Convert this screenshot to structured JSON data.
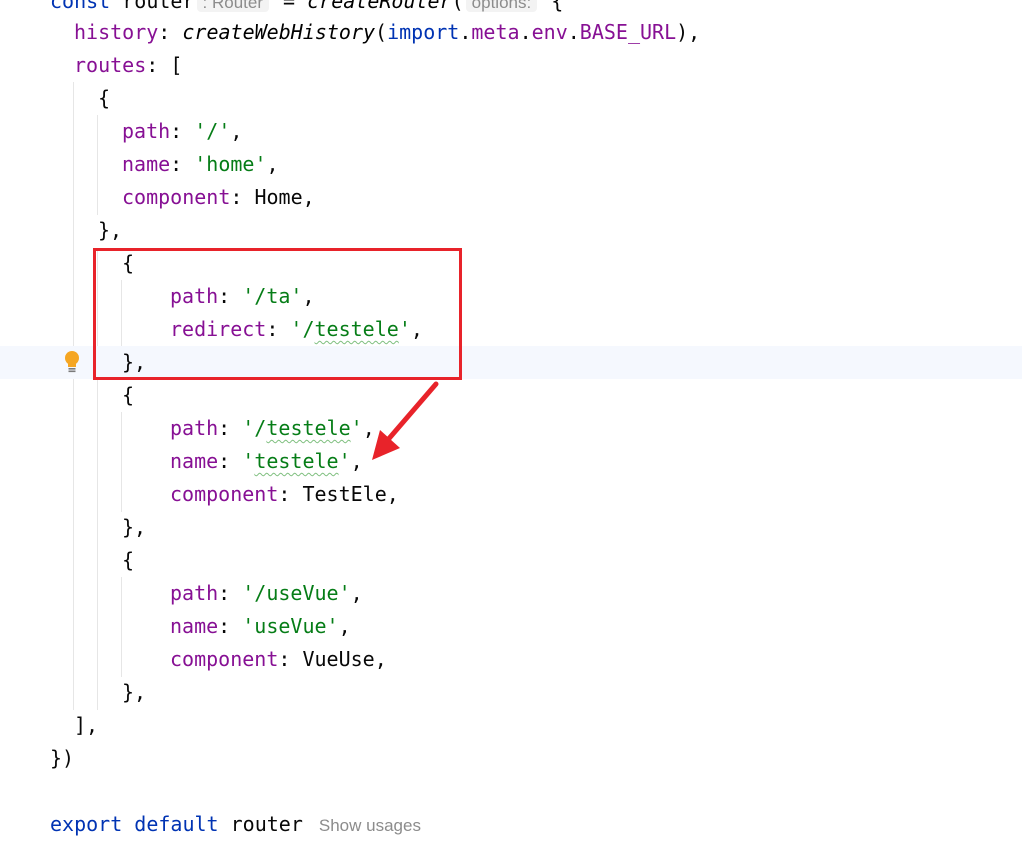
{
  "editor": {
    "l0": {
      "kw": "const",
      "id": "router",
      "hint": ": Router",
      "eq": " = ",
      "fn": "createRouter",
      "open": "(",
      "hint2": "options:",
      "brace": " {"
    },
    "l1": {
      "prop": "history",
      "colon": ": ",
      "fn": "createWebHistory",
      "p1": "(",
      "kw": "import",
      "d1": ".",
      "c1": "meta",
      "d2": ".",
      "c2": "env",
      "d3": ".",
      "c3": "BASE_URL",
      "end": "),"
    },
    "l2": {
      "prop": "routes",
      "rest": ": ["
    },
    "l3": {
      "text": "{"
    },
    "l4": {
      "prop": "path",
      "colon": ": ",
      "str": "'/'",
      "end": ","
    },
    "l5": {
      "prop": "name",
      "colon": ": ",
      "str": "'home'",
      "end": ","
    },
    "l6": {
      "prop": "component",
      "colon": ": ",
      "val": "Home,"
    },
    "l7": {
      "text": "},"
    },
    "l8": {
      "text": "{"
    },
    "l9": {
      "prop": "path",
      "colon": ": ",
      "str": "'/ta'",
      "end": ","
    },
    "l10": {
      "prop": "redirect",
      "colon": ": ",
      "q1": "'/",
      "sq": "testele",
      "q2": "'",
      "end": ","
    },
    "l11": {
      "text": "},"
    },
    "l12": {
      "text": "{"
    },
    "l13": {
      "prop": "path",
      "colon": ": ",
      "q1": "'/",
      "sq": "testele",
      "q2": "'",
      "end": ","
    },
    "l14": {
      "prop": "name",
      "colon": ": ",
      "q1": "'",
      "sq": "testele",
      "q2": "'",
      "end": ","
    },
    "l15": {
      "prop": "component",
      "colon": ": ",
      "val": "TestEle,"
    },
    "l16": {
      "text": "},"
    },
    "l17": {
      "text": "{"
    },
    "l18": {
      "prop": "path",
      "colon": ": ",
      "str": "'/useVue'",
      "end": ","
    },
    "l19": {
      "prop": "name",
      "colon": ": ",
      "str": "'useVue'",
      "end": ","
    },
    "l20": {
      "prop": "component",
      "colon": ": ",
      "val": "VueUse,"
    },
    "l21": {
      "text": "},"
    },
    "l22": {
      "text": "],"
    },
    "l23": {
      "text": "})"
    },
    "l25": {
      "kw1": "export",
      "kw2": "default",
      "id": "router",
      "usages": "Show usages"
    }
  },
  "icons": {
    "bulb": "lightbulb-icon",
    "arrow": "annotation-arrow-icon"
  },
  "colors": {
    "keyword": "#0033b3",
    "property": "#871094",
    "string": "#067d17",
    "annotation": "#e8232a",
    "bulb": "#f5a623"
  }
}
